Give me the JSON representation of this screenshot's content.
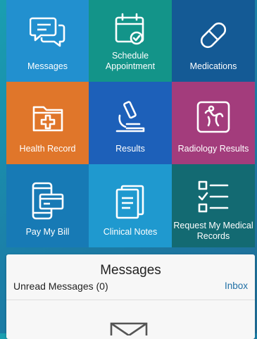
{
  "tiles": [
    {
      "label": "Messages",
      "color": "#2290cf",
      "icon": "chat-bubbles-icon"
    },
    {
      "label": "Schedule\nAppointment",
      "color": "#139489",
      "icon": "calendar-check-icon"
    },
    {
      "label": "Medications",
      "color": "#145a95",
      "icon": "pill-icon"
    },
    {
      "label": "Health Record",
      "color": "#e0762a",
      "icon": "medical-folder-icon"
    },
    {
      "label": "Results",
      "color": "#1d60b9",
      "icon": "microscope-icon"
    },
    {
      "label": "Radiology Results",
      "color": "#a33c7c",
      "icon": "xray-icon"
    },
    {
      "label": "Pay My Bill",
      "color": "#177ab5",
      "icon": "phone-payment-icon"
    },
    {
      "label": "Clinical Notes",
      "color": "#1f99cf",
      "icon": "notes-icon"
    },
    {
      "label": "Request My Medical\nRecords",
      "color": "#136a72",
      "icon": "checklist-icon"
    }
  ],
  "messages_card": {
    "title": "Messages",
    "unread_label": "Unread Messages (0)",
    "inbox_link": "Inbox",
    "icon": "envelope-icon"
  }
}
